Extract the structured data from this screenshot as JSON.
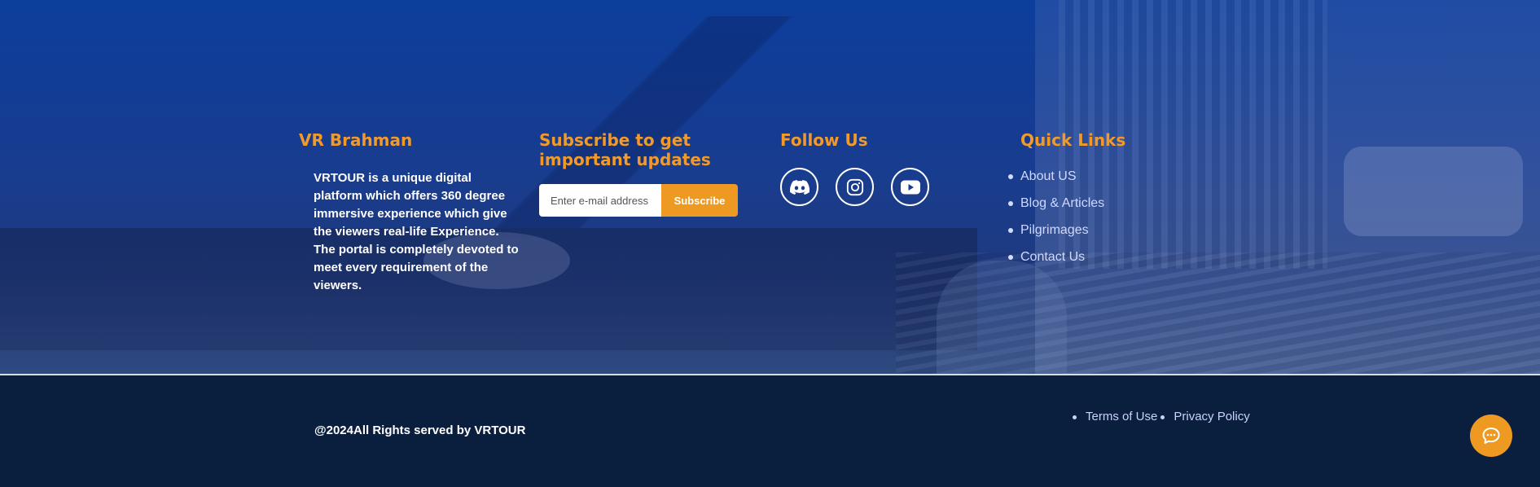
{
  "about": {
    "title": "VR Brahman",
    "text": "VRTOUR is a unique digital platform which offers 360 degree immersive experience which give the viewers real-life Experience. The portal is completely devoted to meet every requirement of the viewers."
  },
  "subscribe": {
    "title": "Subscribe to get important updates",
    "placeholder": "Enter e-mail address",
    "button_label": "Subscribe"
  },
  "follow": {
    "title": "Follow Us",
    "icons": [
      "discord-icon",
      "instagram-icon",
      "youtube-icon"
    ]
  },
  "quick_links": {
    "title": "Quick Links",
    "items": [
      {
        "label": "About US"
      },
      {
        "label": "Blog & Articles"
      },
      {
        "label": "Pilgrimages"
      },
      {
        "label": "Contact Us"
      }
    ]
  },
  "bottom": {
    "copyright": "@2024All Rights served by VRTOUR",
    "legal_links": [
      {
        "label": "Terms of Use"
      },
      {
        "label": "Privacy Policy"
      }
    ]
  },
  "colors": {
    "accent": "#ee9a22",
    "footer_top_blue": "#0c3e9c",
    "footer_bottom": "#0a1f3e"
  },
  "chat": {
    "icon": "chat-bubble-icon"
  }
}
